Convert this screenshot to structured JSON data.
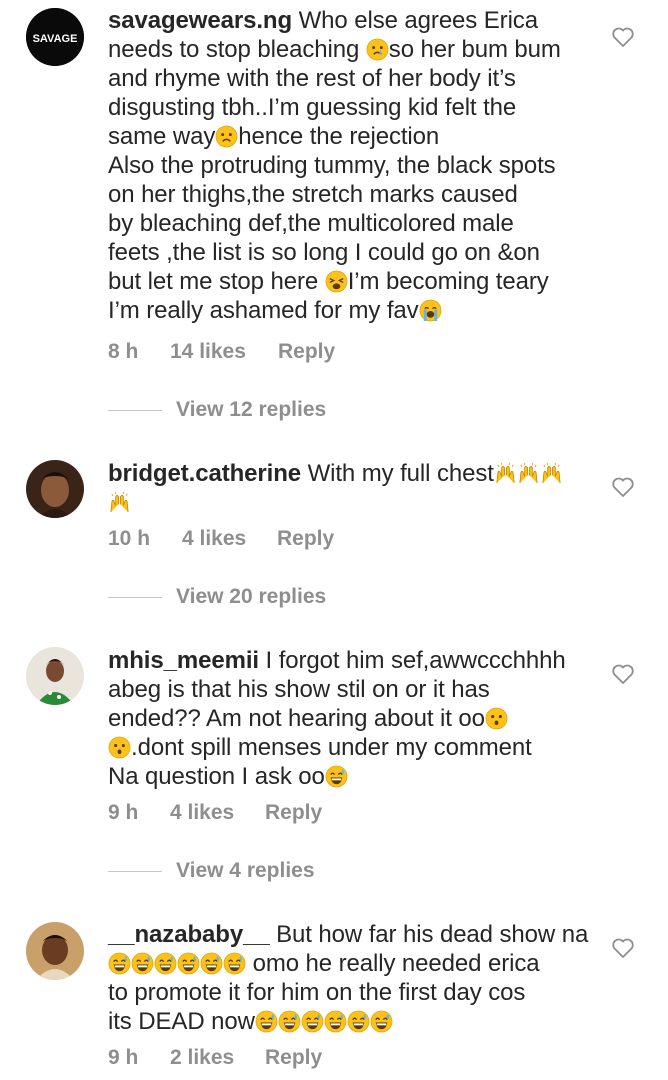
{
  "comments": [
    {
      "avatar_text": "SAVAGE",
      "lines": [
        {
          "pre": "savagewears.ng",
          "text": " Who else agrees Erica"
        },
        {
          "text": "needs to stop bleaching ",
          "emoji": "worried-face",
          "post": "so her bum bum"
        },
        {
          "text": "and rhyme with the rest of her body it’s"
        },
        {
          "text": "disgusting tbh..I’m guessing kid felt the"
        },
        {
          "text": "same way",
          "emoji": "frowning-face",
          "post": "hence the rejection"
        },
        {
          "text": "Also the protruding tummy, the black spots"
        },
        {
          "text": "on her thighs,the stretch marks caused"
        },
        {
          "text": "by bleaching def,the multicolored male"
        },
        {
          "text": "feets ,the list is so long I could go on &on"
        },
        {
          "text": "but let me stop here ",
          "emoji": "weary-face",
          "post": "I’m becoming teary"
        },
        {
          "text": "I’m really ashamed for my fav",
          "emoji": "crying-face",
          "post": ""
        }
      ],
      "time": "8 h",
      "likes": "14 likes",
      "reply": "Reply",
      "view_replies": "View 12 replies"
    },
    {
      "lines": [
        {
          "pre": "bridget.catherine",
          "text": " With my full chest",
          "emoji": "raised-hands-x3",
          "post": ""
        },
        {
          "text": "",
          "emoji": "raised-hands",
          "post": ""
        }
      ],
      "time": "10 h",
      "likes": "4 likes",
      "reply": "Reply",
      "view_replies": "View 20 replies"
    },
    {
      "lines": [
        {
          "pre": "mhis_meemii",
          "text": " I forgot him sef,awwccchhhh"
        },
        {
          "text": "abeg is that his show stil on or it has"
        },
        {
          "text": "ended?? Am not hearing about it oo",
          "emoji": "hushed-face",
          "post": ""
        },
        {
          "text": "",
          "emoji": "hushed-face",
          "post": ".dont spill menses under my comment"
        },
        {
          "text": "Na question I ask oo",
          "emoji": "grinning-sweat-face",
          "post": ""
        }
      ],
      "time": "9 h",
      "likes": "4 likes",
      "reply": "Reply",
      "view_replies": "View 4 replies"
    },
    {
      "lines": [
        {
          "pre": "__nazababy__",
          "text": " But how far his dead show na"
        },
        {
          "text": "",
          "emoji": "grinning-sweat-face-x6",
          "post": " omo he really needed erica"
        },
        {
          "text": "to promote it for him on the first day cos"
        },
        {
          "text": "its DEAD now",
          "emoji": "grinning-sweat-face-x6",
          "post": ""
        }
      ],
      "time": "9 h",
      "likes": "2 likes",
      "reply": "Reply"
    }
  ],
  "icons": {
    "like": "heart-outline-icon"
  },
  "colors": {
    "text": "#262626",
    "muted": "#8e8e8e",
    "emoji_yellow": "#fcc21b"
  }
}
